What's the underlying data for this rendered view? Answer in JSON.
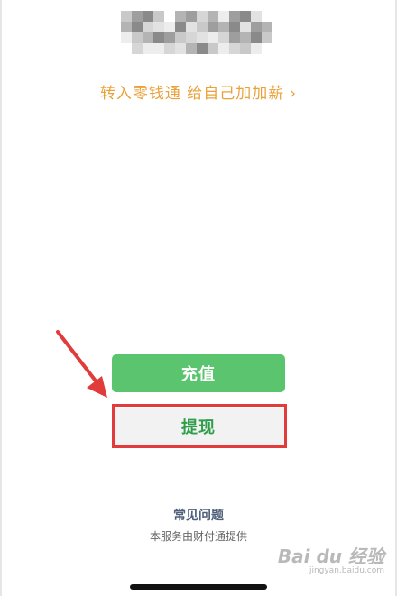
{
  "balance": {
    "obscured": true,
    "mosaic_colors": [
      "#c9c9c9",
      "#9e9e9e",
      "#e2e2e2",
      "#b4b4b4",
      "#ededed",
      "#8a8a8a",
      "#d6d6d6"
    ]
  },
  "promo": {
    "text": "转入零钱通 给自己加加薪",
    "chevron": "›",
    "color": "#e9a23b"
  },
  "actions": {
    "recharge_label": "充值",
    "withdraw_label": "提现",
    "recharge_color": "#5ac46e",
    "withdraw_text_color": "#2f9e4b"
  },
  "annotation": {
    "highlight_color": "#e23b3b",
    "arrow_color": "#e23b3b"
  },
  "help": {
    "faq_label": "常见问题",
    "provider_text": "本服务由财付通提供"
  },
  "watermark": {
    "logo_text": "Bai du 经验",
    "sub_text": "jingyan.baidu.com"
  }
}
